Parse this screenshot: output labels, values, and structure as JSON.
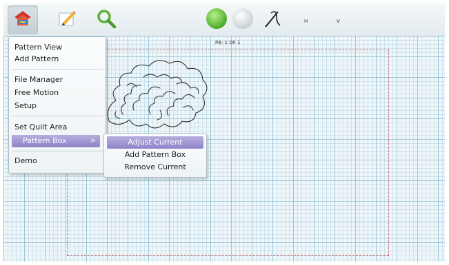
{
  "toolbar": {
    "buttons": [
      {
        "icon": "quilt-menu-icon",
        "pressed": true
      },
      {
        "icon": "pencil-icon",
        "pressed": false
      },
      {
        "icon": "search-icon",
        "pressed": false
      },
      {
        "icon": "green-circle-icon",
        "pressed": false
      },
      {
        "icon": "grey-circle-icon",
        "pressed": false
      },
      {
        "icon": "needle-icon",
        "pressed": false
      }
    ],
    "h_label": "H",
    "v_label": "V"
  },
  "canvas": {
    "pb_label": "PB: 1 OF 1"
  },
  "menu": {
    "items": [
      {
        "label": "Pattern View"
      },
      {
        "label": "Add Pattern"
      },
      {
        "label": "File Manager"
      },
      {
        "label": "Free Motion"
      },
      {
        "label": "Setup"
      },
      {
        "label": "Set Quilt Area"
      },
      {
        "label": "Pattern Box",
        "highlighted": true,
        "submenu": true
      },
      {
        "label": "Demo"
      }
    ],
    "submenu_arrow": ">"
  },
  "submenu": {
    "items": [
      {
        "label": "Adjust Current",
        "highlighted": true
      },
      {
        "label": "Add Pattern Box"
      },
      {
        "label": "Remove Current"
      }
    ]
  },
  "colors": {
    "highlight": "#9d92d2",
    "grid": "#78afc8",
    "quilt_border": "#d06a6a",
    "green_button": "#5dbb3c"
  }
}
